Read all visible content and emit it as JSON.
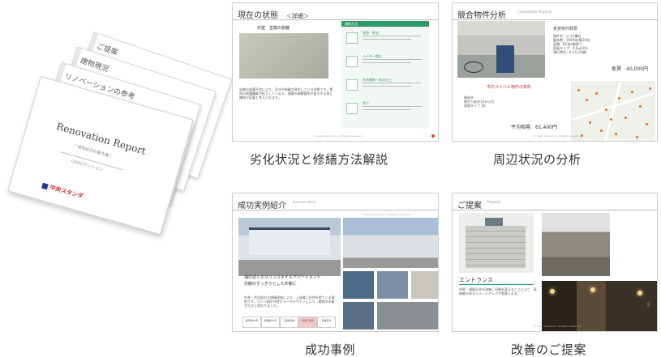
{
  "report": {
    "tab1": "ご提案",
    "tab2": "建物現況",
    "tab3": "リノベーションの参考",
    "cover_tab": "",
    "title": "Renovation Report",
    "subtitle": "（ 現地状況の報告書 ）",
    "property": "OOOOマンション",
    "logo_text": "中央スタンダ"
  },
  "cards": [
    {
      "title": "現在の状態",
      "title_sub": "＜詳細＞",
      "photo_label": "外壁　塗膜の剥離",
      "body": "塗装の塗膜不良により、浮きや剥離が発生している状態です。素材の保護機能が低下しています。塗膜の剥離箇所が拡大する前に補修が必要と考えられます。",
      "panel_head": "補修方法",
      "steps": [
        "洗浄・除去",
        "ハイター除去",
        "劣化補修・防水仕上",
        "完了"
      ],
      "footer": "© Asahi Kentei Inc. All Rights Reserved",
      "caption": "劣化状況と修繕方法解説"
    },
    {
      "title": "競合物件分析",
      "title_sub": "Competitive Property",
      "props_head": "賃貸物件概要",
      "props": [
        "物件名：ビル5番町",
        "築年数：1999年(築20年)",
        "面積：RC造4階建て",
        "部屋タイプ：9.6㎡(1K)",
        "現行賃料：8.2万(月額)"
      ],
      "rent": "家賃　40,000円",
      "sub": "市内ライバル物件の賃料",
      "list": [
        "駅徒歩",
        "駅から徒歩15分以内",
        "部屋タイプ 1K"
      ],
      "avg": "平均相場　61,400円",
      "footer": "© Asahi Kentei Inc. All Rights Reserved",
      "caption": "周辺状況の分析"
    },
    {
      "title": "成功実例紹介",
      "title_sub": "Success Story",
      "quote": "海の近くのマリンスタイルアパートメント\n外観のすっきりとした外観に",
      "body": "外装・共用部の大規模改修により、入居者に好評を得ている事例です。マリン調の外壁カラーやデザインにより、建物の印象が大きく変わりました。",
      "table": [
        "築年数20年",
        "部屋数18戸",
        "工事費用約",
        "利回り改善",
        "家賃変化"
      ],
      "footer": "© Asahi Kentei Inc. All Rights Reserved",
      "caption": "成功事例"
    },
    {
      "title": "ご提案",
      "title_sub": "Proposal",
      "entrance": "エントランス",
      "body": "外壁・通路天井を改善し印象を変えることにより、高級感のあるイメージアップが実現します。",
      "footer": "© Asahi Kentei Inc. All Rights Reserved",
      "caption": "改善のご提案"
    }
  ],
  "colors": {
    "accent_green": "#2e9b65",
    "accent_red": "#c0393b",
    "map_dot": "#ef6c1e"
  }
}
